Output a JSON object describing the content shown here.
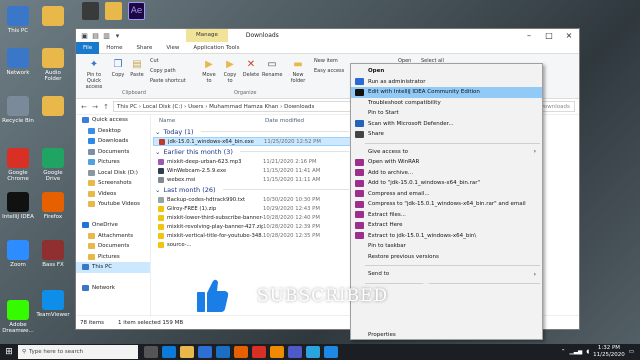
{
  "desktop": {
    "icons": [
      {
        "label": "This PC",
        "icon": "computer-icon",
        "color": "#3a77c9"
      },
      {
        "label": "Network",
        "icon": "network-icon",
        "color": "#3a77c9"
      },
      {
        "label": "Recycle Bin",
        "icon": "recycle-bin-icon",
        "color": "#7a8a9a"
      },
      {
        "label": "Google Chrome",
        "icon": "chrome-icon",
        "color": "#d93025"
      },
      {
        "label": "IntelliJ IDEA",
        "icon": "intellij-icon",
        "color": "#111"
      },
      {
        "label": "Zoom",
        "icon": "zoom-icon",
        "color": "#2d8cff"
      },
      {
        "label": "Adobe Dreamwe...",
        "icon": "dreamweaver-icon",
        "color": "#35fa00"
      },
      {
        "label": "",
        "icon": "folder-icon",
        "color": "#e8b84a"
      },
      {
        "label": "Audio Folder",
        "icon": "folder-icon",
        "color": "#e8b84a"
      },
      {
        "label": "",
        "icon": "folder-icon",
        "color": "#e8b84a"
      },
      {
        "label": "Google Drive",
        "icon": "google-drive-icon",
        "color": "#1fa463"
      },
      {
        "label": "Firefox",
        "icon": "firefox-icon",
        "color": "#e66000"
      },
      {
        "label": "Bass FX",
        "icon": "app-icon",
        "color": "#8f2f2f"
      },
      {
        "label": "TeamViewer",
        "icon": "teamviewer-icon",
        "color": "#0e8ee9"
      }
    ]
  },
  "explorer": {
    "manage_tab": "Manage",
    "title": "Downloads",
    "tabs": [
      "File",
      "Home",
      "Share",
      "View",
      "Application Tools"
    ],
    "ribbon": {
      "pin": "Pin to Quick access",
      "copy": "Copy",
      "paste": "Paste",
      "cut": "Cut",
      "copy_path": "Copy path",
      "paste_shortcut": "Paste shortcut",
      "clipboard": "Clipboard",
      "move_to": "Move to",
      "copy_to": "Copy to",
      "delete": "Delete",
      "rename": "Rename",
      "organize": "Organize",
      "new_folder": "New folder",
      "new_item": "New item",
      "easy_access": "Easy access",
      "open": "Open",
      "select_all": "Select all"
    },
    "address": "This PC  ›  Local Disk (C:)  ›  Users  ›  Muhammad Hamza Khan  ›  Downloads",
    "search_placeholder": "Search Downloads",
    "nav": [
      {
        "label": "Quick access",
        "color": "#3b7ddd"
      },
      {
        "label": "Desktop",
        "color": "#3a8ee6"
      },
      {
        "label": "Downloads",
        "color": "#2d89e8"
      },
      {
        "label": "Documents",
        "color": "#7d8ea6"
      },
      {
        "label": "Pictures",
        "color": "#4fa3e0"
      },
      {
        "label": "Local Disk (D:)",
        "color": "#8c96a3"
      },
      {
        "label": "Screenshots",
        "color": "#e8b84a"
      },
      {
        "label": "Videos",
        "color": "#e8b84a"
      },
      {
        "label": "Youtube Videos",
        "color": "#e8b84a"
      },
      {
        "label": "",
        "color": "#ffffff"
      },
      {
        "label": "OneDrive",
        "color": "#1f74d8"
      },
      {
        "label": "Attachments",
        "color": "#e8b84a"
      },
      {
        "label": "Documents",
        "color": "#e8b84a"
      },
      {
        "label": "Pictures",
        "color": "#e8b84a"
      },
      {
        "label": "This PC",
        "color": "#3a77c9"
      },
      {
        "label": "",
        "color": "#ffffff"
      },
      {
        "label": "Network",
        "color": "#3a77c9"
      }
    ],
    "columns": [
      "Name",
      "Date modified"
    ],
    "groups": [
      {
        "title": "Today (1)",
        "files": [
          {
            "name": "jdk-15.0.1_windows-x64_bin.exe",
            "date": "11/25/2020 12:52 PM",
            "color": "#c0392b",
            "selected": true
          }
        ]
      },
      {
        "title": "Earlier this month (3)",
        "files": [
          {
            "name": "mixkit-deep-urban-623.mp3",
            "date": "11/21/2020 2:16 PM",
            "color": "#9b59b6",
            "selected": false
          },
          {
            "name": "WinWebcam-2.5.9.exe",
            "date": "11/15/2020 11:41 AM",
            "color": "#2c3e50",
            "selected": false
          },
          {
            "name": "webex.msi",
            "date": "11/15/2020 11:11 AM",
            "color": "#7f8c8d",
            "selected": false
          }
        ]
      },
      {
        "title": "Last month (26)",
        "files": [
          {
            "name": "Backup-codes-hdtrack990.txt",
            "date": "10/30/2020 10:30 PM",
            "color": "#95a5a6",
            "selected": false
          },
          {
            "name": "Gilroy-FREE (1).zip",
            "date": "10/29/2020 12:43 PM",
            "color": "#f1c40f",
            "selected": false
          },
          {
            "name": "mixkit-lower-third-subscribe-banner-429...",
            "date": "10/28/2020 12:40 PM",
            "color": "#f1c40f",
            "selected": false
          },
          {
            "name": "mixkit-revolving-play-banner-427.zip",
            "date": "10/28/2020 12:39 PM",
            "color": "#f1c40f",
            "selected": false
          },
          {
            "name": "mixkit-vertical-title-for-youtube-348.zip",
            "date": "10/28/2020 12:35 PM",
            "color": "#f1c40f",
            "selected": false
          },
          {
            "name": "source-...",
            "date": "",
            "color": "#f1c40f",
            "selected": false
          }
        ]
      }
    ],
    "status": {
      "count": "78 items",
      "selection": "1 item selected  159 MB"
    }
  },
  "context_menu": {
    "items": [
      {
        "label": "Open",
        "icon": "",
        "bold": true,
        "highlight": false,
        "arrow": false,
        "sep_before": false
      },
      {
        "label": "Run as administrator",
        "icon": "shield-icon",
        "bold": false,
        "highlight": false,
        "arrow": false,
        "sep_before": false
      },
      {
        "label": "Edit with IntelliJ IDEA Community Edition",
        "icon": "intellij-icon",
        "bold": false,
        "highlight": true,
        "arrow": false,
        "sep_before": false
      },
      {
        "label": "Troubleshoot compatibility",
        "icon": "",
        "bold": false,
        "highlight": false,
        "arrow": false,
        "sep_before": false
      },
      {
        "label": "Pin to Start",
        "icon": "",
        "bold": false,
        "highlight": false,
        "arrow": false,
        "sep_before": false
      },
      {
        "label": "Scan with Microsoft Defender...",
        "icon": "defender-icon",
        "bold": false,
        "highlight": false,
        "arrow": false,
        "sep_before": false
      },
      {
        "label": "Share",
        "icon": "share-icon",
        "bold": false,
        "highlight": false,
        "arrow": false,
        "sep_before": false
      },
      {
        "label": "Give access to",
        "icon": "",
        "bold": false,
        "highlight": false,
        "arrow": true,
        "sep_before": true
      },
      {
        "label": "Open with WinRAR",
        "icon": "winrar-icon",
        "bold": false,
        "highlight": false,
        "arrow": false,
        "sep_before": false
      },
      {
        "label": "Add to archive...",
        "icon": "winrar-icon",
        "bold": false,
        "highlight": false,
        "arrow": false,
        "sep_before": false
      },
      {
        "label": "Add to \"jdk-15.0.1_windows-x64_bin.rar\"",
        "icon": "winrar-icon",
        "bold": false,
        "highlight": false,
        "arrow": false,
        "sep_before": false
      },
      {
        "label": "Compress and email...",
        "icon": "winrar-icon",
        "bold": false,
        "highlight": false,
        "arrow": false,
        "sep_before": false
      },
      {
        "label": "Compress to \"jdk-15.0.1_windows-x64_bin.rar\" and email",
        "icon": "winrar-icon",
        "bold": false,
        "highlight": false,
        "arrow": false,
        "sep_before": false
      },
      {
        "label": "Extract files...",
        "icon": "winrar-icon",
        "bold": false,
        "highlight": false,
        "arrow": false,
        "sep_before": false
      },
      {
        "label": "Extract Here",
        "icon": "winrar-icon",
        "bold": false,
        "highlight": false,
        "arrow": false,
        "sep_before": false
      },
      {
        "label": "Extract to jdk-15.0.1_windows-x64_bin\\",
        "icon": "winrar-icon",
        "bold": false,
        "highlight": false,
        "arrow": false,
        "sep_before": false
      },
      {
        "label": "Pin to taskbar",
        "icon": "",
        "bold": false,
        "highlight": false,
        "arrow": false,
        "sep_before": false
      },
      {
        "label": "Restore previous versions",
        "icon": "",
        "bold": false,
        "highlight": false,
        "arrow": false,
        "sep_before": false
      },
      {
        "label": "Send to",
        "icon": "",
        "bold": false,
        "highlight": false,
        "arrow": true,
        "sep_before": true
      },
      {
        "label": "Properties",
        "icon": "",
        "bold": false,
        "highlight": false,
        "arrow": false,
        "sep_before": true
      }
    ]
  },
  "overlay": {
    "subscribed_text": "SUBSCRIBED"
  },
  "taskbar": {
    "search_placeholder": "Type here to search",
    "apps": [
      {
        "icon": "task-view-icon",
        "color": "#555"
      },
      {
        "icon": "edge-icon",
        "color": "#0c7ad6"
      },
      {
        "icon": "file-explorer-icon",
        "color": "#e8b84a"
      },
      {
        "icon": "store-icon",
        "color": "#2d6fd2"
      },
      {
        "icon": "mail-icon",
        "color": "#1b6ec2"
      },
      {
        "icon": "firefox-icon",
        "color": "#e66000"
      },
      {
        "icon": "chrome-icon",
        "color": "#d93025"
      },
      {
        "icon": "vlc-icon",
        "color": "#f08a00"
      },
      {
        "icon": "teams-icon",
        "color": "#5059c9"
      },
      {
        "icon": "telegram-icon",
        "color": "#2aa3de"
      },
      {
        "icon": "photos-icon",
        "color": "#1e88e5"
      }
    ],
    "time": "1:32 PM",
    "date": "11/25/2020"
  }
}
